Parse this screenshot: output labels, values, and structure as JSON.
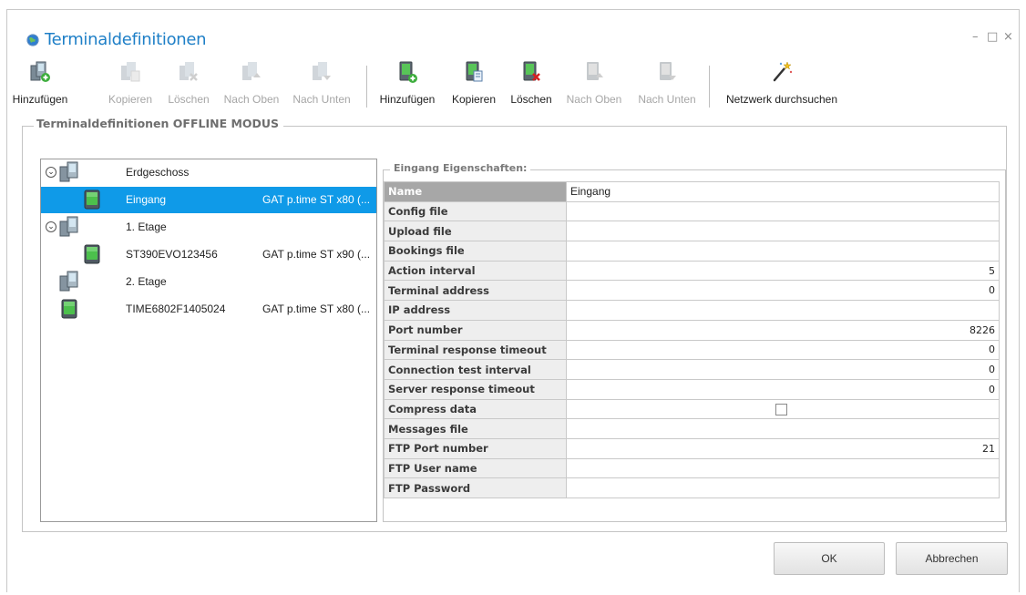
{
  "window": {
    "title": "Terminaldefinitionen",
    "controls": {
      "minimize": "–",
      "maximize": "□",
      "close": "×"
    }
  },
  "toolbar": {
    "group_buttons": [
      {
        "label": "Hinzufügen",
        "icon": "group-add-icon",
        "enabled": true
      },
      {
        "label": "Kopieren",
        "icon": "group-copy-icon",
        "enabled": false
      },
      {
        "label": "Löschen",
        "icon": "group-delete-icon",
        "enabled": false
      },
      {
        "label": "Nach Oben",
        "icon": "group-move-up-icon",
        "enabled": false
      },
      {
        "label": "Nach Unten",
        "icon": "group-move-down-icon",
        "enabled": false
      }
    ],
    "terminal_buttons": [
      {
        "label": "Hinzufügen",
        "icon": "terminal-add-icon",
        "enabled": true
      },
      {
        "label": "Kopieren",
        "icon": "terminal-copy-icon",
        "enabled": true
      },
      {
        "label": "Löschen",
        "icon": "terminal-delete-icon",
        "enabled": true
      },
      {
        "label": "Nach Oben",
        "icon": "terminal-move-up-icon",
        "enabled": false
      },
      {
        "label": "Nach Unten",
        "icon": "terminal-move-down-icon",
        "enabled": false
      }
    ],
    "network_search": {
      "label": "Netzwerk durchsuchen",
      "icon": "magic-wand-icon",
      "enabled": true
    }
  },
  "group_box": {
    "title": "Terminaldefinitionen OFFLINE MODUS"
  },
  "tree": {
    "rows": [
      {
        "kind": "group",
        "name": "Erdgeschoss",
        "type": "",
        "collapsible": true,
        "selected": false
      },
      {
        "kind": "terminal",
        "name": "Eingang",
        "type": "GAT p.time ST x80 (...",
        "selected": true
      },
      {
        "kind": "group",
        "name": "1. Etage",
        "type": "",
        "collapsible": true,
        "selected": false
      },
      {
        "kind": "terminal",
        "name": "ST390EVO123456",
        "type": "GAT p.time ST x90 (...",
        "selected": false
      },
      {
        "kind": "group",
        "name": "2. Etage",
        "type": "",
        "collapsible": false,
        "selected": false
      },
      {
        "kind": "terminal",
        "name": "TIME6802F1405024",
        "type": "GAT p.time ST x80 (...",
        "selected": false
      }
    ]
  },
  "properties": {
    "title": "Eingang Eigenschaften:",
    "rows": [
      {
        "key": "Name",
        "value": "Eingang",
        "numeric": false,
        "selected": true
      },
      {
        "key": "Config file",
        "value": "",
        "numeric": false
      },
      {
        "key": "Upload file",
        "value": "",
        "numeric": false
      },
      {
        "key": "Bookings file",
        "value": "",
        "numeric": false
      },
      {
        "key": "Action interval",
        "value": "5",
        "numeric": true
      },
      {
        "key": "Terminal address",
        "value": "0",
        "numeric": true
      },
      {
        "key": "IP address",
        "value": "",
        "numeric": false
      },
      {
        "key": "Port number",
        "value": "8226",
        "numeric": true
      },
      {
        "key": "Terminal response timeout",
        "value": "0",
        "numeric": true
      },
      {
        "key": "Connection test interval",
        "value": "0",
        "numeric": true
      },
      {
        "key": "Server response timeout",
        "value": "0",
        "numeric": true
      },
      {
        "key": "Compress data",
        "value": "",
        "checkbox": true,
        "checked": false
      },
      {
        "key": "Messages file",
        "value": "",
        "numeric": false
      },
      {
        "key": "FTP Port number",
        "value": "21",
        "numeric": true
      },
      {
        "key": "FTP User name",
        "value": "",
        "numeric": false
      },
      {
        "key": "FTP Password",
        "value": "",
        "numeric": false
      }
    ]
  },
  "buttons": {
    "ok": "OK",
    "cancel": "Abbrechen"
  },
  "colors": {
    "accent": "#1e7fc7",
    "selection": "#0f9ae8",
    "terminal_green": "#3cb83c"
  }
}
